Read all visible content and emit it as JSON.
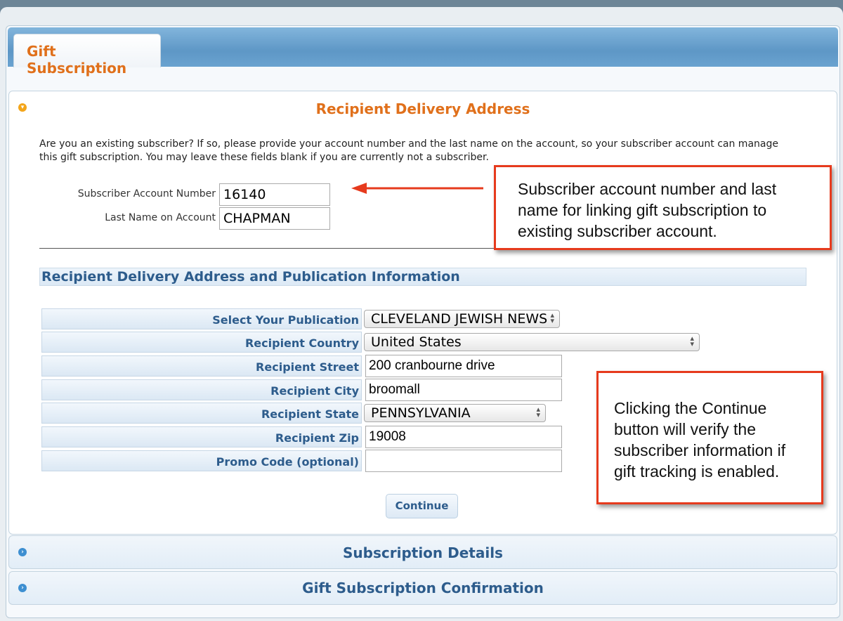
{
  "tab": {
    "label": "Gift Subscription"
  },
  "section1": {
    "title": "Recipient Delivery Address",
    "intro": "Are you an existing subscriber? If so, please provide your account number and the last name on the account, so your subscriber account can manage this gift subscription. You may leave these fields blank if you are currently not a subscriber.",
    "account_label": "Subscriber Account Number",
    "account_value": "16140",
    "lastname_label": "Last Name on Account",
    "lastname_value": "CHAPMAN",
    "subhead": "Recipient Delivery Address and Publication Information",
    "fields": {
      "publication_label": "Select Your Publication",
      "publication_value": "CLEVELAND JEWISH NEWS",
      "country_label": "Recipient Country",
      "country_value": "United States",
      "street_label": "Recipient Street",
      "street_value": "200 cranbourne drive",
      "city_label": "Recipient City",
      "city_value": "broomall",
      "state_label": "Recipient State",
      "state_value": "PENNSYLVANIA",
      "zip_label": "Recipient Zip",
      "zip_value": "19008",
      "promo_label": "Promo Code (optional)",
      "promo_value": ""
    },
    "continue_label": "Continue"
  },
  "section2": {
    "title": "Subscription Details"
  },
  "section3": {
    "title": "Gift Subscription Confirmation"
  },
  "callouts": {
    "account": "Subscriber account number and last name for linking gift subscription to existing subscriber account.",
    "continue": "Clicking the Continue button will verify the subscriber information if gift tracking is enabled."
  },
  "colors": {
    "accent_orange": "#e0701b",
    "heading_blue": "#2d5c8c",
    "callout_red": "#e63a1d"
  }
}
